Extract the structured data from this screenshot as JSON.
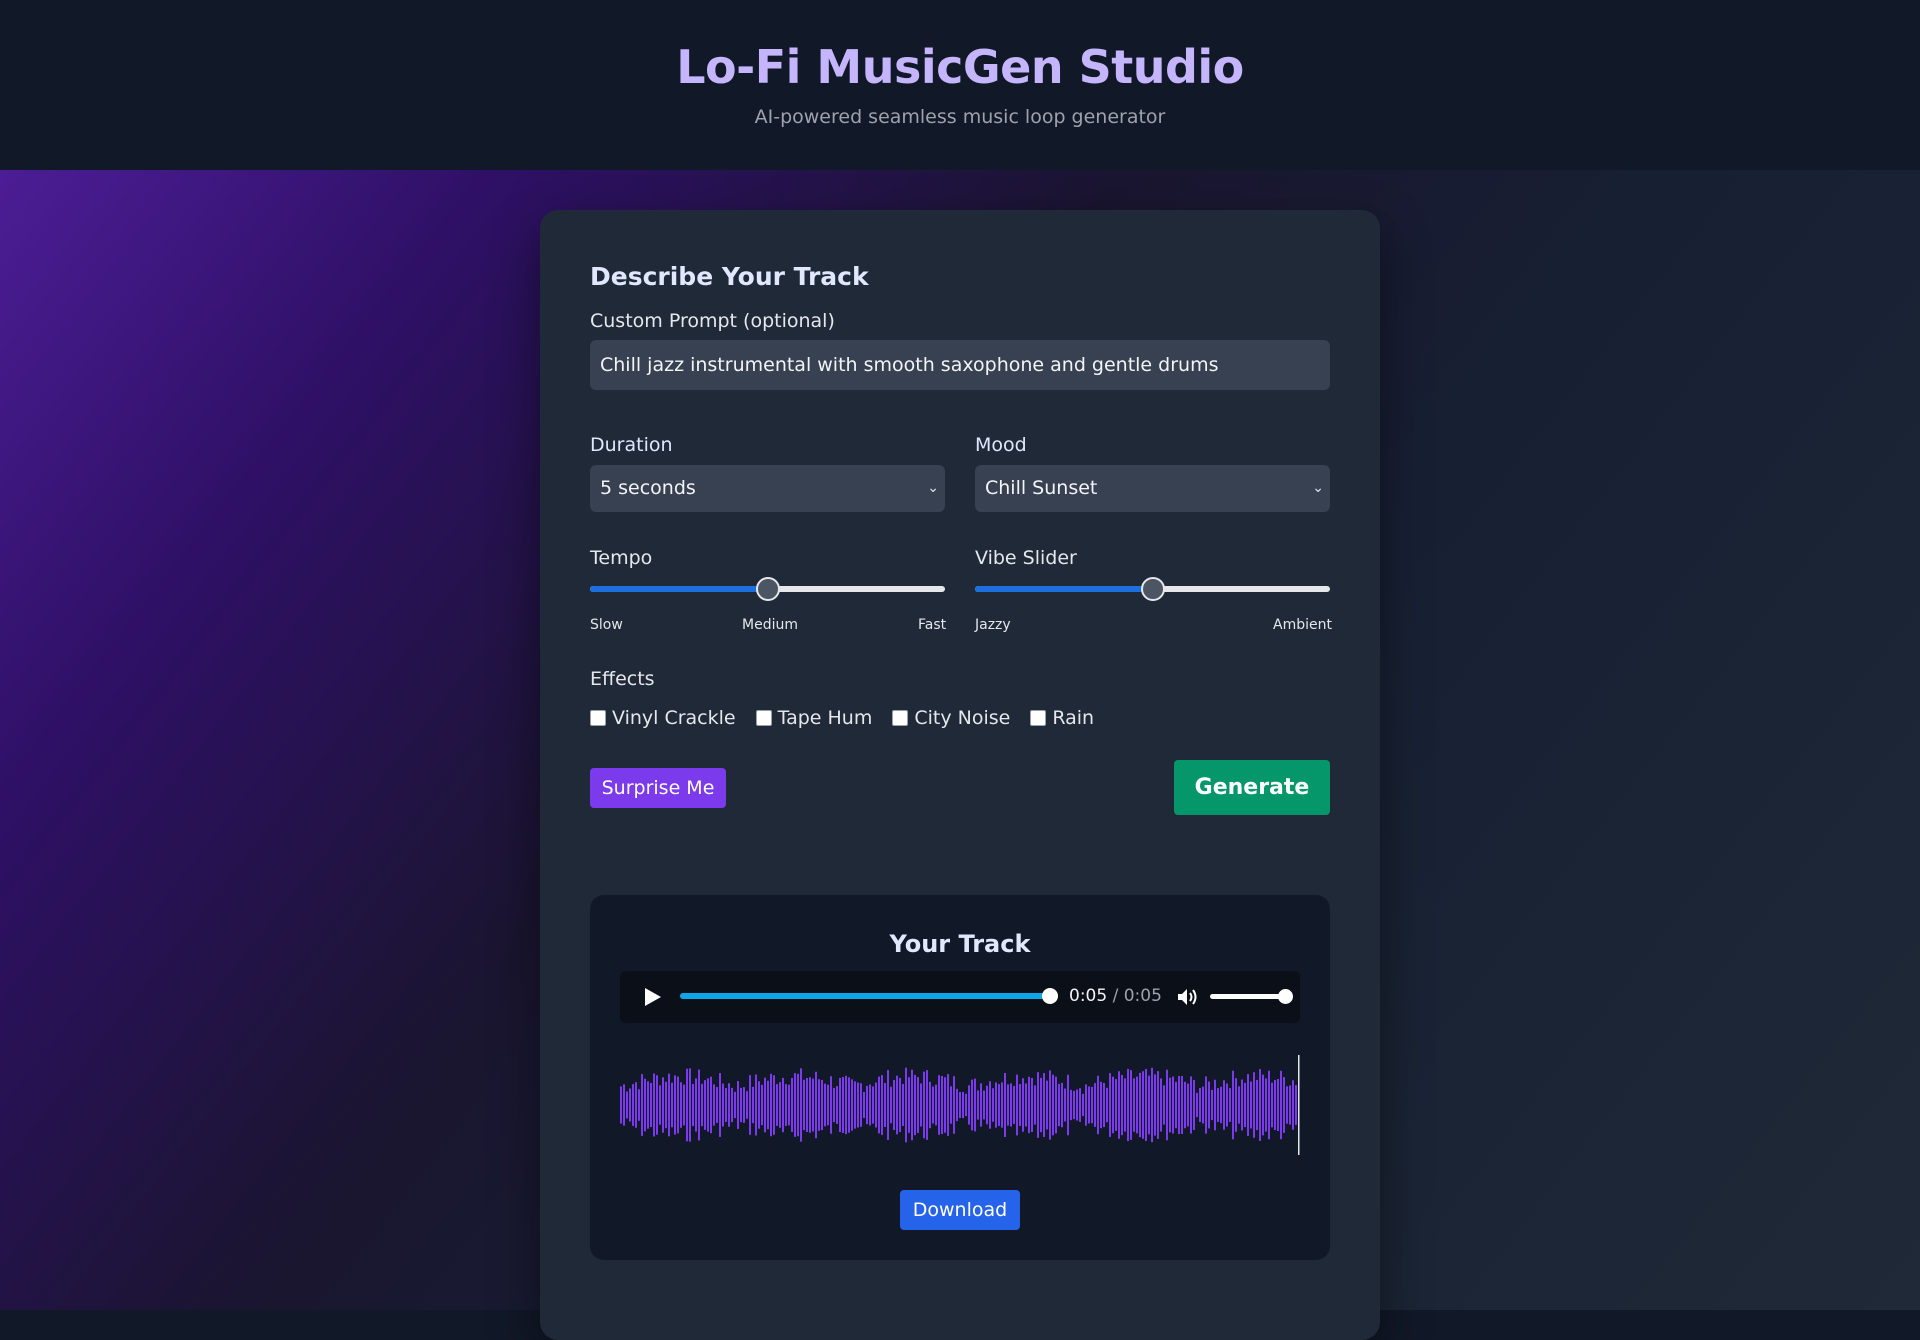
{
  "header": {
    "title": "Lo-Fi MusicGen Studio",
    "subtitle": "AI-powered seamless music loop generator"
  },
  "form": {
    "section_title": "Describe Your Track",
    "prompt_label": "Custom Prompt (optional)",
    "prompt_value": "Chill jazz instrumental with smooth saxophone and gentle drums",
    "duration_label": "Duration",
    "duration_value": "5 seconds",
    "mood_label": "Mood",
    "mood_value": "Chill Sunset",
    "tempo_label": "Tempo",
    "tempo_value": 0.5,
    "tempo_ticks": {
      "left": "Slow",
      "middle": "Medium",
      "right": "Fast"
    },
    "vibe_label": "Vibe Slider",
    "vibe_value": 0.5,
    "vibe_ticks": {
      "left": "Jazzy",
      "right": "Ambient"
    },
    "effects_label": "Effects",
    "effects": [
      {
        "label": "Vinyl Crackle",
        "checked": false
      },
      {
        "label": "Tape Hum",
        "checked": false
      },
      {
        "label": "City Noise",
        "checked": false
      },
      {
        "label": "Rain",
        "checked": false
      }
    ],
    "surprise_label": "Surprise Me",
    "generate_label": "Generate"
  },
  "track": {
    "title": "Your Track",
    "current_time": "0:05",
    "separator": " / ",
    "duration": "0:05",
    "progress": 1.0,
    "volume": 1.0,
    "waveform_color": "#7c3aed",
    "download_label": "Download"
  },
  "colors": {
    "title": "#c4b5fd",
    "accent_purple": "#7c3aed",
    "generate_green": "#059669",
    "slider_blue": "#1d6fe0",
    "download_blue": "#2563eb"
  }
}
